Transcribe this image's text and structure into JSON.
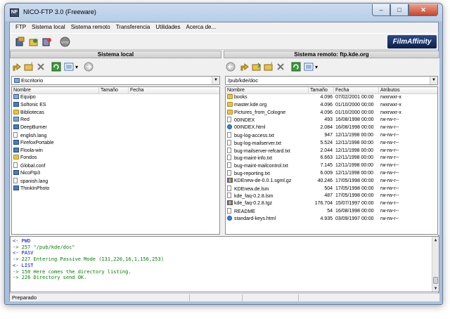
{
  "window": {
    "title": "NICO-FTP 3.0  (Freeware)"
  },
  "menu": [
    "FTP",
    "Sistema local",
    "Sistema remoto",
    "Transferencia",
    "Utilidades",
    "Acerca de..."
  ],
  "brand": "FilmAffinity",
  "local": {
    "header": "Sistema local",
    "path": "Escritorio",
    "columns": {
      "name": "Nombre",
      "size": "Tamaño",
      "date": "Fecha"
    },
    "rows": [
      {
        "name": "Equipo",
        "icon": "drive"
      },
      {
        "name": "Softonic ES",
        "icon": "app"
      },
      {
        "name": "Bibliotecas",
        "icon": "folder"
      },
      {
        "name": "Red",
        "icon": "drive"
      },
      {
        "name": "DeepBurner",
        "icon": "app"
      },
      {
        "name": "english.lang",
        "icon": "file"
      },
      {
        "name": "FirefoxPortable",
        "icon": "app"
      },
      {
        "name": "Floola-win",
        "icon": "app"
      },
      {
        "name": "Fondos",
        "icon": "folder"
      },
      {
        "name": "Global.conf",
        "icon": "file"
      },
      {
        "name": "NicoFtp3",
        "icon": "app"
      },
      {
        "name": "spanish.lang",
        "icon": "file"
      },
      {
        "name": "ThinkInPhoto",
        "icon": "app"
      }
    ]
  },
  "remote": {
    "header": "Sistema remoto: ftp.kde.org",
    "path": "/pub/kde/doc",
    "columns": {
      "name": "Nombre",
      "size": "Tamaño",
      "date": "Fecha",
      "attrs": "Atributos"
    },
    "rows": [
      {
        "name": "books",
        "size": "4.096",
        "date": "07/02/2001 00:00",
        "attrs": "rwxrwxr-x",
        "icon": "folder"
      },
      {
        "name": "master.kde.org",
        "size": "4.096",
        "date": "01/10/2000 00:00",
        "attrs": "rwxrwxr-x",
        "icon": "folder"
      },
      {
        "name": "Pictures_from_Cologne",
        "size": "4.096",
        "date": "01/10/2000 00:00",
        "attrs": "rwxrwxr-x",
        "icon": "folder"
      },
      {
        "name": "00INDEX",
        "size": "493",
        "date": "16/08/1998 00:00",
        "attrs": "rw-rw-r--",
        "icon": "file"
      },
      {
        "name": "00INDEX.html",
        "size": "2.084",
        "date": "16/08/1998 00:00",
        "attrs": "rw-rw-r--",
        "icon": "web"
      },
      {
        "name": "bug-log-access.txt",
        "size": "947",
        "date": "12/11/1998 00:00",
        "attrs": "rw-rw-r--",
        "icon": "file"
      },
      {
        "name": "bug-log-mailserver.txt",
        "size": "5.524",
        "date": "12/11/1998 00:00",
        "attrs": "rw-rw-r--",
        "icon": "file"
      },
      {
        "name": "bug-mailserver-refcard.txt",
        "size": "2.044",
        "date": "12/11/1998 00:00",
        "attrs": "rw-rw-r--",
        "icon": "file"
      },
      {
        "name": "bug-maint-info.txt",
        "size": "6.663",
        "date": "12/11/1998 00:00",
        "attrs": "rw-rw-r--",
        "icon": "file"
      },
      {
        "name": "bug-maint-mailcontrol.txt",
        "size": "7.145",
        "date": "12/11/1998 00:00",
        "attrs": "rw-rw-r--",
        "icon": "file"
      },
      {
        "name": "bug-reporting.txt",
        "size": "6.009",
        "date": "12/11/1998 00:00",
        "attrs": "rw-rw-r--",
        "icon": "file"
      },
      {
        "name": "KDEnew-de-0.0.1.sgml.gz",
        "size": "40.246",
        "date": "17/05/1998 00:00",
        "attrs": "rw-rw-r--",
        "icon": "arch"
      },
      {
        "name": "KDEnew.de.lsm",
        "size": "504",
        "date": "17/05/1998 00:00",
        "attrs": "rw-rw-r--",
        "icon": "file"
      },
      {
        "name": "kde_faq-0.2.8.lsm",
        "size": "487",
        "date": "17/05/1998 00:00",
        "attrs": "rw-rw-r--",
        "icon": "file"
      },
      {
        "name": "kde_faq-0.2.8.tgz",
        "size": "176.704",
        "date": "15/07/1997 00:00",
        "attrs": "rw-rw-r--",
        "icon": "arch"
      },
      {
        "name": "README",
        "size": "54",
        "date": "16/08/1998 00:00",
        "attrs": "rw-rw-r--",
        "icon": "file"
      },
      {
        "name": "standard-keys.html",
        "size": "4.935",
        "date": "03/09/1997 00:00",
        "attrs": "rw-rw-r--",
        "icon": "web"
      }
    ]
  },
  "log": [
    {
      "text": "<- PWD",
      "kind": "cmd"
    },
    {
      "text": "-> 257 \"/pub/kde/doc\"",
      "kind": "resp"
    },
    {
      "text": "<- PASV",
      "kind": "cmd"
    },
    {
      "text": "-> 227 Entering Passive Mode (131,220,16,1,156,253)",
      "kind": "resp"
    },
    {
      "text": "<- LIST",
      "kind": "cmd"
    },
    {
      "text": "-> 150 Here comes the directory listing.",
      "kind": "resp"
    },
    {
      "text": "-> 226 Directory send OK.",
      "kind": "resp"
    }
  ],
  "status": "Preparado",
  "colors": {
    "cmd": "#0000cc",
    "resp": "#008000",
    "folder": "#e9c24a"
  }
}
